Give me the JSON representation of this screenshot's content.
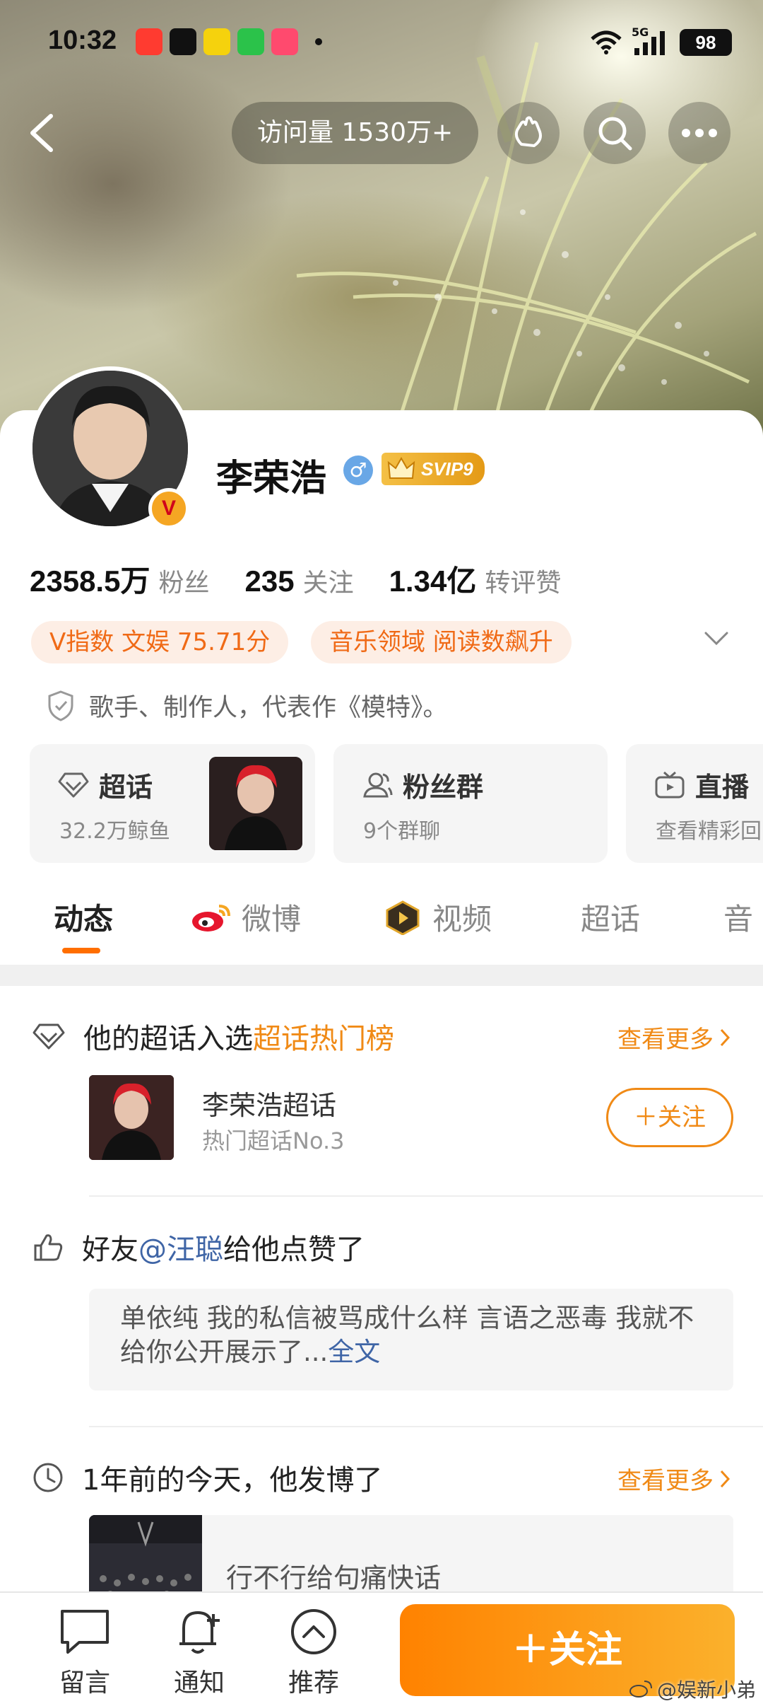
{
  "status_bar": {
    "time": "10:32",
    "signal_label": "5G",
    "battery": "98"
  },
  "nav": {
    "visits": "访问量 1530万+"
  },
  "profile": {
    "name": "李荣浩",
    "gender_symbol": "♂",
    "vip_badge": "SVIP9",
    "v_badge": "V",
    "bio": "歌手、制作人，代表作《模特》。",
    "stats": [
      {
        "value": "2358.5万",
        "label": "粉丝"
      },
      {
        "value": "235",
        "label": "关注"
      },
      {
        "value": "1.34亿",
        "label": "转评赞"
      }
    ],
    "tags": [
      "V指数 文娱 75.71分",
      "音乐领域 阅读数飙升"
    ]
  },
  "features": [
    {
      "title": "超话",
      "subtitle": "32.2万鲸鱼"
    },
    {
      "title": "粉丝群",
      "subtitle": "9个群聊"
    },
    {
      "title": "直播",
      "subtitle": "查看精彩回"
    }
  ],
  "tabs": [
    "动态",
    "微博",
    "视频",
    "超话",
    "音"
  ],
  "super_topic_section": {
    "prefix": "他的超话入选",
    "highlight": "超话热门榜",
    "more": "查看更多",
    "item_title": "李荣浩超话",
    "item_subtitle": "热门超话No.3",
    "follow": "＋关注"
  },
  "like_section": {
    "prefix": "好友",
    "mention": "@汪聪",
    "suffix": "给他点赞了",
    "quote": "单依纯 我的私信被骂成什么样 言语之恶毒 我就不给你公开展示了...",
    "full_text": "全文"
  },
  "memory_section": {
    "title": "1年前的今天，他发博了",
    "more": "查看更多",
    "post_text": "行不行给句痛快话"
  },
  "bottom_bar": {
    "items": [
      "留言",
      "通知",
      "推荐"
    ],
    "follow": "＋关注",
    "watermark": "@娱新小弟"
  },
  "colors": {
    "accent": "#ff8200",
    "link": "#3f65a6",
    "tag_bg": "#fdeee5"
  }
}
